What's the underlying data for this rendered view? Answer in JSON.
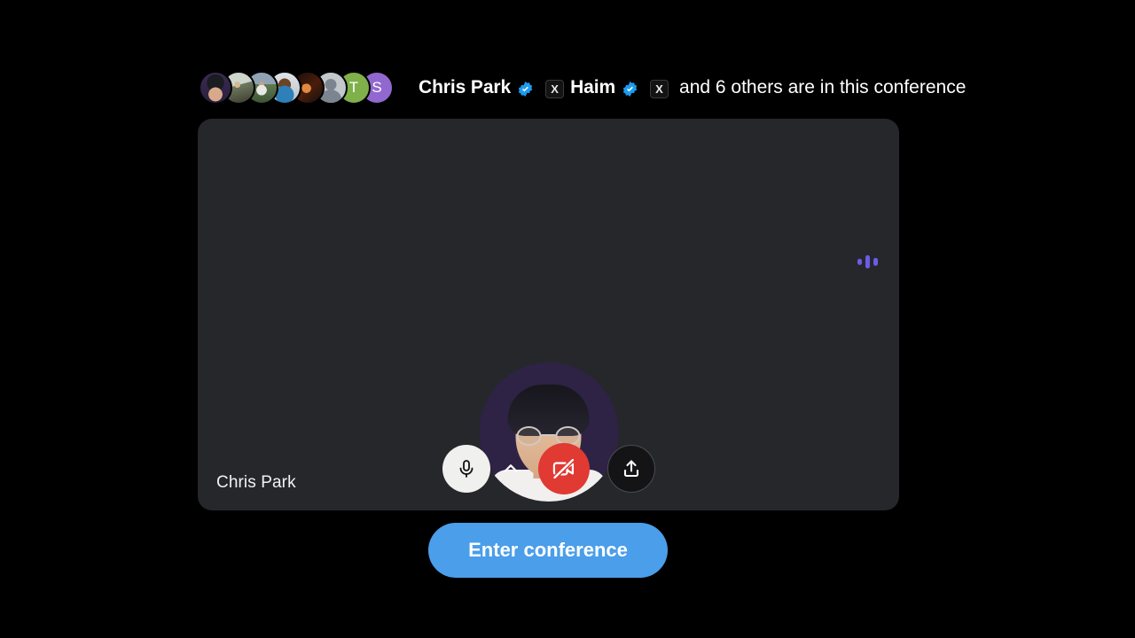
{
  "theme": {
    "background": "#000000",
    "panel_bg": "#26272b",
    "accent_blue": "#4a9eea",
    "verified_blue": "#1d9bf0",
    "danger_red": "#e03a33",
    "indicator_purple": "#6b5ce7"
  },
  "header": {
    "participants_stack": [
      {
        "name": "avatar-chris-park",
        "type": "photo",
        "initial": ""
      },
      {
        "name": "avatar-cyclist",
        "type": "photo",
        "initial": ""
      },
      {
        "name": "avatar-hiker",
        "type": "photo",
        "initial": ""
      },
      {
        "name": "avatar-person-blue",
        "type": "photo",
        "initial": ""
      },
      {
        "name": "avatar-person-dark",
        "type": "photo",
        "initial": ""
      },
      {
        "name": "avatar-default-person",
        "type": "placeholder",
        "initial": ""
      },
      {
        "name": "avatar-initial-t",
        "type": "initial",
        "initial": "T"
      },
      {
        "name": "avatar-initial-s",
        "type": "initial",
        "initial": "S"
      }
    ],
    "name_1": "Chris Park",
    "name_2": "Haim",
    "badge_x_label": "X",
    "rest_text": "and 6 others are in this conference",
    "verified_icon": "verified-badge-icon"
  },
  "panel": {
    "level_indicator": "audio-level-indicator",
    "self_name": "Chris Park",
    "self_avatar_icon": "self-avatar-photo"
  },
  "controls": {
    "mic": {
      "label": "microphone-on",
      "icon": "microphone-icon",
      "state": "on"
    },
    "mic_options": {
      "label": "audio-device-options",
      "icon": "chevron-up-icon"
    },
    "camera": {
      "label": "camera-off",
      "icon": "camera-off-icon",
      "state": "off"
    },
    "share": {
      "label": "share-screen",
      "icon": "share-upload-icon"
    }
  },
  "footer": {
    "enter_label": "Enter conference"
  }
}
